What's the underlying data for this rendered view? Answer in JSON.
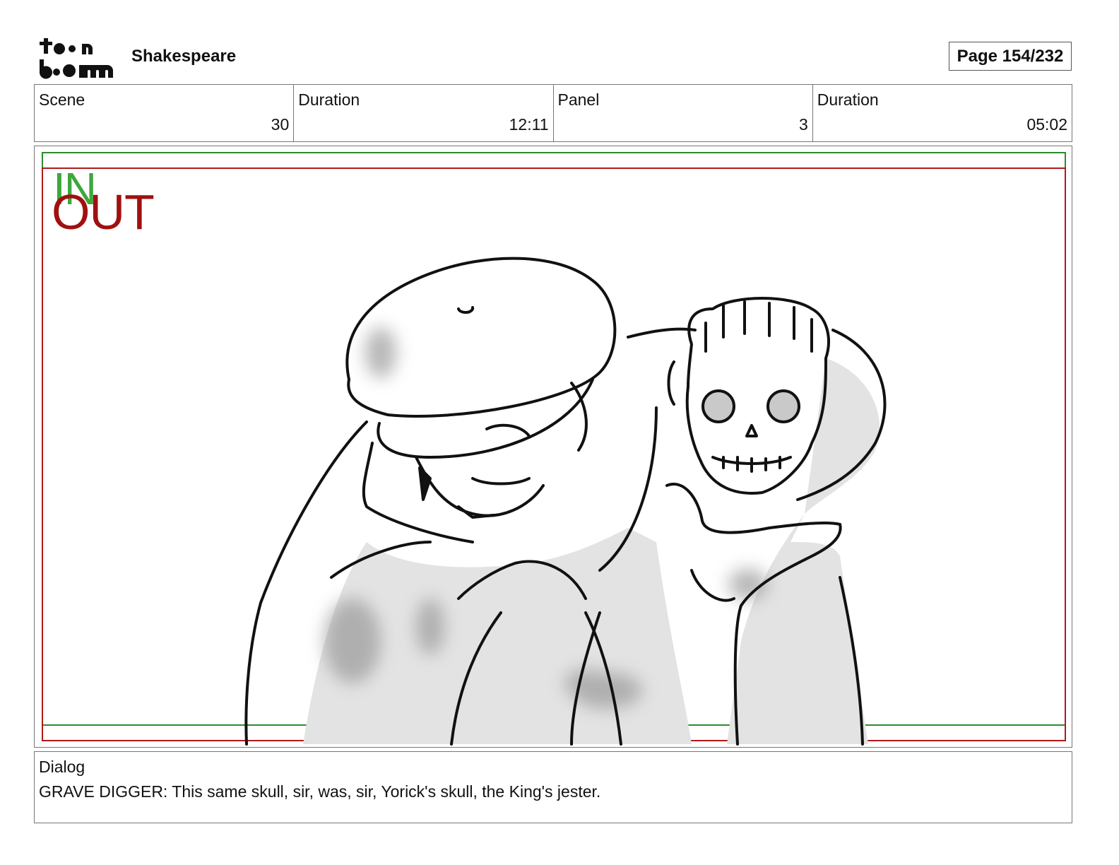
{
  "header": {
    "logo_text": "toon boom",
    "project_title": "Shakespeare",
    "page_label": "Page 154/232"
  },
  "info": {
    "scene_label": "Scene",
    "scene_value": "30",
    "scene_duration_label": "Duration",
    "scene_duration_value": "12:11",
    "panel_label": "Panel",
    "panel_value": "3",
    "panel_duration_label": "Duration",
    "panel_duration_value": "05:02"
  },
  "panel": {
    "in_mark": "IN",
    "out_mark": "OUT",
    "in_color": "#3ca83c",
    "out_color": "#a01010",
    "illustration": "grave-digger-holding-skull-sketch"
  },
  "dialog": {
    "label": "Dialog",
    "text": "GRAVE DIGGER: This same skull, sir, was, sir, Yorick's skull, the King's jester."
  }
}
